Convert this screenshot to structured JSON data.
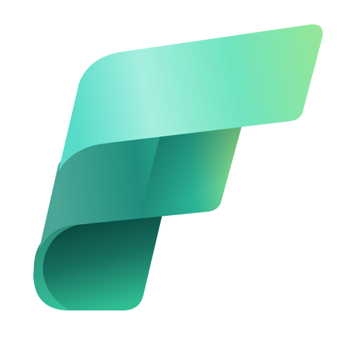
{
  "canvas": {
    "background": "#ffffff"
  },
  "logo": {
    "icon": "fabric-f-logo-icon",
    "colors": {
      "top_band_start": "#5fe0c6",
      "top_band_highlight": "#a8f0e0",
      "top_band_end": "#8fe39e",
      "middle_band_start": "#3f9f8d",
      "middle_band_mid": "#2bb39a",
      "middle_band_end": "#8fe08e",
      "bottom_band_start": "#0b4f46",
      "bottom_band_end": "#2fbf94"
    }
  }
}
